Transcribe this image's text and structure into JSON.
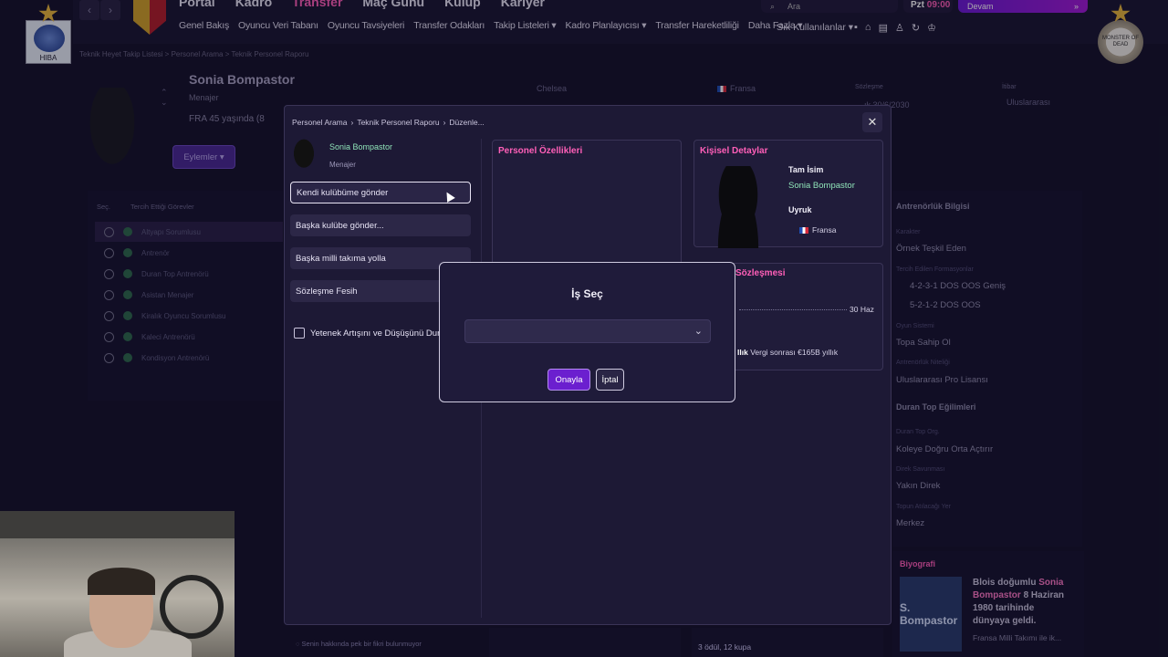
{
  "topnav": {
    "main_menu": [
      "Portal",
      "Kadro",
      "Transfer",
      "Maç Günü",
      "Kulüp",
      "Kariyer"
    ],
    "active_main": "Transfer",
    "sub_menu": [
      "Genel Bakış",
      "Oyuncu Veri Tabanı",
      "Oyuncu Tavsiyeleri",
      "Transfer Odakları",
      "Takip Listeleri ▾",
      "Kadro Planlayıcısı ▾",
      "Transfer Hareketliliği",
      "Daha Fazla ▾"
    ],
    "sik": "Sık Kullanılanlar ▾",
    "search_label": "Ara",
    "date_day": "Pzt",
    "date_time": "09:00",
    "continue_label": "Devam",
    "left_logo_text": "HIBA",
    "right_logo_text": "MONSTER OF DEAD"
  },
  "background": {
    "breadcrumb": "Teknik Heyet Takip Listesi  >  Personel Arama  >  Teknik Personel Raporu",
    "name": "Sonia Bompastor",
    "role": "Menajer",
    "nationality": "FRA  45 yaşında (8",
    "actions_label": "Eylemler ▾",
    "club": "Chelsea",
    "country": "Fransa",
    "contract_label": "Sözleşme",
    "contract_value": "ık 30/6/2030",
    "status_label": "İtibar",
    "status_value": "Uluslararası",
    "side_head_a": "Seç.",
    "side_head_b": "Tercih Ettiği Görevler",
    "roles": [
      "Altyapı Sorumlusu",
      "Antrenör",
      "Duran Top Antrenörü",
      "Asistan Menajer",
      "Kiralık Oyuncu Sorumlusu",
      "Kaleci Antrenörü",
      "Kondisyon Antrenörü"
    ],
    "right_panel": {
      "title": "Antrenörlük Bilgisi",
      "items": [
        {
          "label": "Karakter",
          "value": "Örnek Teşkil Eden"
        },
        {
          "label": "Tercih Edilen Formasyonlar",
          "value": "4-2-3-1 DOS OOS Geniş"
        },
        {
          "label": "",
          "value": "5-2-1-2 DOS OOS"
        },
        {
          "label": "Oyun Sistemi",
          "value": "Topa Sahip Ol"
        },
        {
          "label": "Antrenörlük Niteliği",
          "value": "Uluslararası Pro Lisansı"
        },
        {
          "label": "",
          "value": "Duran Top Eğilimleri"
        },
        {
          "label": "Duran Top Org.",
          "value": "Koleye Doğru Orta Açtırır"
        },
        {
          "label": "Direk Savunması",
          "value": "Yakın Direk"
        },
        {
          "label": "Topun Atılacağı Yer",
          "value": "Merkez"
        }
      ]
    },
    "bio_title": "Biyografi",
    "bio_img_text": "S. Bompastor",
    "bio_text_1": "Blois doğumlu ",
    "bio_name": "Sonia Bompastor",
    "bio_text_2": " 8 Haziran 1980 tarihinde dünyaya geldi.",
    "bio_text_3": "Fransa Milli Takımı ile ik...",
    "footer_note": "Senin hakkında pek bir fikri bulunmuyor",
    "footer_note2": "3 ödül, 12 kupa"
  },
  "modal": {
    "breadcrumb": [
      "Personel Arama",
      "Teknik Personel Raporu",
      "Düzenle..."
    ],
    "name": "Sonia Bompastor",
    "role": "Menajer",
    "actions": [
      "Kendi kulübüme gönder",
      "Başka kulübe gönder...",
      "Başka milli takıma yolla",
      "Sözleşme Fesih"
    ],
    "checkbox_label": "Yetenek Artışını ve Düşüşünü Durdur",
    "card1_title": "Personel Özellikleri",
    "card2_title": "Kişisel Detaylar",
    "full_name_label": "Tam İsim",
    "full_name": "Sonia Bompastor",
    "nationality_label": "Uyruk",
    "nationality": "Fransa",
    "contract_title": "Sözleşmesi",
    "contract_end": "30 Haz",
    "tax_bold": "llık",
    "tax_text": "Vergi sonrası €165B yıllık"
  },
  "dialog": {
    "title": "İş Seç",
    "select_value": "",
    "confirm_label": "Onayla",
    "cancel_label": "İptal"
  }
}
